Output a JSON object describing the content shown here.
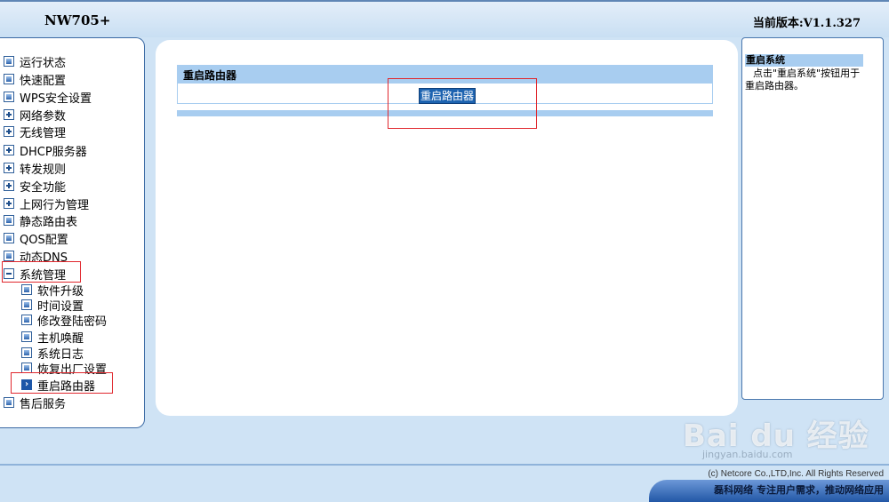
{
  "header": {
    "brand": "NW705+",
    "version": "当前版本:V1.1.327"
  },
  "sidebar": {
    "items": [
      {
        "label": "运行状态",
        "icon": "bullet-icon"
      },
      {
        "label": "快速配置",
        "icon": "bullet-icon"
      },
      {
        "label": "WPS安全设置",
        "icon": "bullet-icon"
      },
      {
        "label": "网络参数",
        "icon": "expand-plus-icon"
      },
      {
        "label": "无线管理",
        "icon": "expand-plus-icon"
      },
      {
        "label": "DHCP服务器",
        "icon": "expand-plus-icon"
      },
      {
        "label": "转发规则",
        "icon": "expand-plus-icon"
      },
      {
        "label": "安全功能",
        "icon": "expand-plus-icon"
      },
      {
        "label": "上网行为管理",
        "icon": "expand-plus-icon"
      },
      {
        "label": "静态路由表",
        "icon": "bullet-icon"
      },
      {
        "label": "QOS配置",
        "icon": "bullet-icon"
      },
      {
        "label": "动态DNS",
        "icon": "bullet-icon"
      },
      {
        "label": "系统管理",
        "icon": "collapse-minus-icon"
      },
      {
        "label": "售后服务",
        "icon": "bullet-icon"
      }
    ],
    "sub_items": [
      {
        "label": "软件升级",
        "icon": "bullet-icon"
      },
      {
        "label": "时间设置",
        "icon": "bullet-icon"
      },
      {
        "label": "修改登陆密码",
        "icon": "bullet-icon"
      },
      {
        "label": "主机唤醒",
        "icon": "bullet-icon"
      },
      {
        "label": "系统日志",
        "icon": "bullet-icon"
      },
      {
        "label": "恢复出厂设置",
        "icon": "bullet-icon"
      },
      {
        "label": "重启路由器",
        "icon": "arrow-right-icon"
      }
    ]
  },
  "main": {
    "section_title": "重启路由器",
    "reboot_button": "重启路由器"
  },
  "help": {
    "title": "重启系统",
    "text": "点击\"重启系统\"按钮用于重启路由器。"
  },
  "footer": {
    "copyright": "(c) Netcore Co.,LTD,Inc. All Rights Reserved",
    "slogan": "磊科网络 专注用户需求，推动网络应用"
  },
  "watermark": {
    "text": "Bai du 经验",
    "sub": "jingyan.baidu.com"
  }
}
